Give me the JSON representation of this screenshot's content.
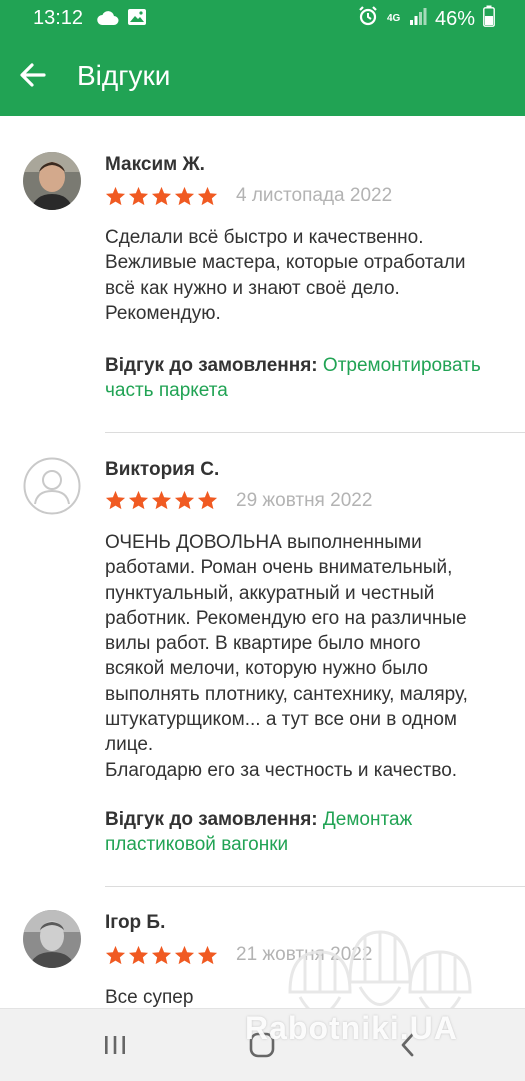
{
  "status_bar": {
    "time": "13:12",
    "network": "4G",
    "battery": "46%",
    "icons": [
      "cloud-icon",
      "image-icon",
      "alarm-icon",
      "signal-icon",
      "battery-icon"
    ]
  },
  "app_bar": {
    "title": "Відгуки",
    "back_icon": "arrow-left-icon"
  },
  "colors": {
    "brand_green": "#21a354",
    "star_orange": "#f05a22",
    "date_gray": "#b3b3b3"
  },
  "reviews": [
    {
      "author": "Максим Ж.",
      "rating": 5,
      "date": "4 листопада 2022",
      "text": "Сделали всё быстро и качественно.\nВежливые мастера, которые отработали\nвсё как нужно и знают своё дело.\nРекомендую.",
      "order_label": "Відгук до замовлення:",
      "order_link": "Отремонтировать часть паркета"
    },
    {
      "author": "Виктория С.",
      "rating": 5,
      "date": "29 жовтня 2022",
      "text": "ОЧЕНЬ ДОВОЛЬНА выполненными\nработами. Роман очень внимательный,\nпунктуальный, аккуратный и честный\nработник. Рекомендую его на различные\nвилы работ. В квартире было много\nвсякой мелочи, которую нужно было\nвыполнять плотнику, сантехнику, маляру,\nштукатурщиком... а тут все они в одном\nлице.\nБлагодарю его за честность и качество.",
      "order_label": "Відгук до замовлення:",
      "order_link": "Демонтаж пластиковой вагонки"
    },
    {
      "author": "Ігор Б.",
      "rating": 5,
      "date": "21 жовтня 2022",
      "text": "Все супер"
    }
  ],
  "watermark": "Rabotniki.UA",
  "nav_bar": {
    "icons": [
      "recent-apps-icon",
      "home-icon",
      "back-icon"
    ]
  }
}
